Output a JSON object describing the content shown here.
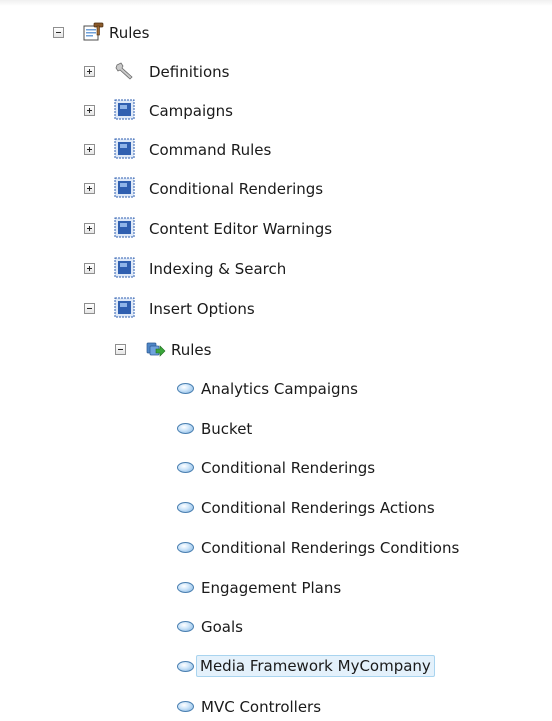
{
  "tree": {
    "root": {
      "label": "Rules",
      "state": "expanded",
      "icon": "folder-hammer-icon"
    },
    "children": [
      {
        "label": "Definitions",
        "state": "collapsed",
        "icon": "wrench-icon"
      },
      {
        "label": "Campaigns",
        "state": "collapsed",
        "icon": "blue-box-icon"
      },
      {
        "label": "Command Rules",
        "state": "collapsed",
        "icon": "blue-box-icon"
      },
      {
        "label": "Conditional Renderings",
        "state": "collapsed",
        "icon": "blue-box-icon"
      },
      {
        "label": "Content Editor Warnings",
        "state": "collapsed",
        "icon": "blue-box-icon"
      },
      {
        "label": "Indexing & Search",
        "state": "collapsed",
        "icon": "blue-box-icon"
      },
      {
        "label": "Insert Options",
        "state": "expanded",
        "icon": "blue-box-icon"
      }
    ],
    "insert_options_rules": {
      "label": "Rules",
      "state": "expanded",
      "icon": "rules-arrow-icon",
      "items": [
        {
          "label": "Analytics Campaigns",
          "selected": false
        },
        {
          "label": "Bucket",
          "selected": false
        },
        {
          "label": "Conditional Renderings",
          "selected": false
        },
        {
          "label": "Conditional Renderings Actions",
          "selected": false
        },
        {
          "label": "Conditional Renderings Conditions",
          "selected": false
        },
        {
          "label": "Engagement Plans",
          "selected": false
        },
        {
          "label": "Goals",
          "selected": false
        },
        {
          "label": "Media Framework MyCompany",
          "selected": true
        },
        {
          "label": "MVC Controllers",
          "selected": false
        }
      ]
    }
  },
  "colors": {
    "selection_background": "#e4f1fb",
    "selection_border": "#a9d4ef",
    "blue_icon": "#2f5fb0"
  }
}
